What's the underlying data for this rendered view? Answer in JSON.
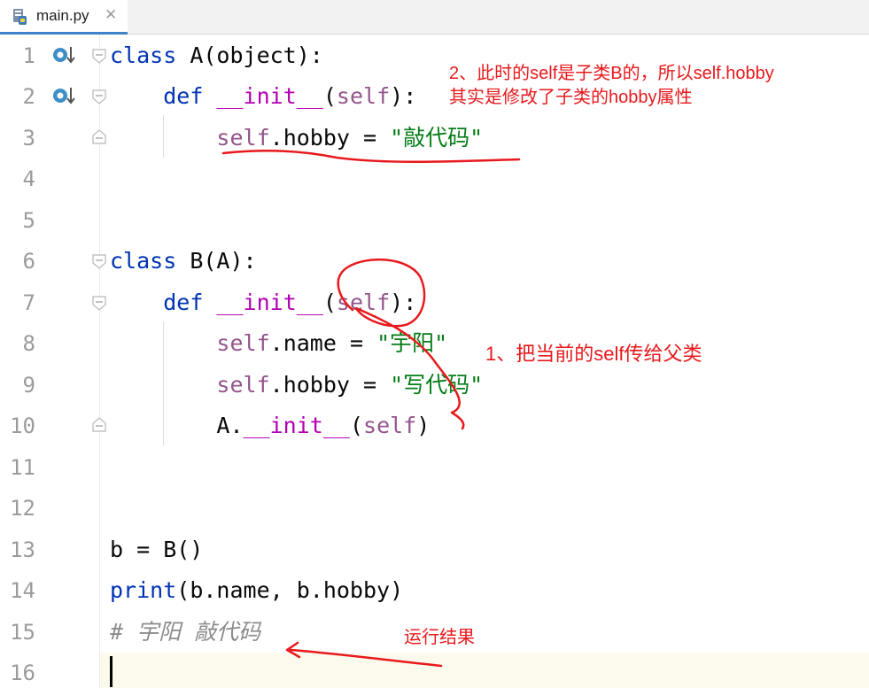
{
  "tab": {
    "filename": "main.py",
    "close": "✕"
  },
  "line_numbers": [
    "1",
    "2",
    "3",
    "4",
    "5",
    "6",
    "7",
    "8",
    "9",
    "10",
    "11",
    "12",
    "13",
    "14",
    "15",
    "16"
  ],
  "code": {
    "l1": {
      "kw": "class",
      "rest": " A(object):"
    },
    "l2": {
      "kw": "def",
      "pre": "    ",
      "name": "__init__",
      "open": "(",
      "self": "self",
      "close": "):"
    },
    "l3": {
      "pre": "        ",
      "self": "self",
      "mid": ".hobby = ",
      "str": "\"敲代码\""
    },
    "l6": {
      "kw": "class",
      "rest": " B(A):"
    },
    "l7": {
      "kw": "def",
      "pre": "    ",
      "name": "__init__",
      "open": "(",
      "self": "self",
      "close": "):"
    },
    "l8": {
      "pre": "        ",
      "self": "self",
      "mid": ".name = ",
      "str": "\"宇阳\""
    },
    "l9": {
      "pre": "        ",
      "self": "self",
      "mid": ".hobby = ",
      "str": "\"写代码\""
    },
    "l10": {
      "pre": "        ",
      "cls": "A.",
      "name": "__init__",
      "open": "(",
      "self": "self",
      "close": ")"
    },
    "l13": {
      "text": "b = B()"
    },
    "l14": {
      "fn": "print",
      "rest": "(b.name, b.hobby)"
    },
    "l15": {
      "comment": "# 宇阳 敲代码"
    }
  },
  "annotations": {
    "note2_line1": "2、此时的self是子类B的，所以self.hobby",
    "note2_line2": "其实是修改了子类的hobby属性",
    "note1": "1、把当前的self传给父类",
    "result": "运行结果"
  },
  "colors": {
    "keyword": "#0033b3",
    "self": "#94558d",
    "string": "#067d17",
    "dunder": "#b200b2",
    "comment": "#8c8c8c",
    "annotation": "#e8191c"
  }
}
